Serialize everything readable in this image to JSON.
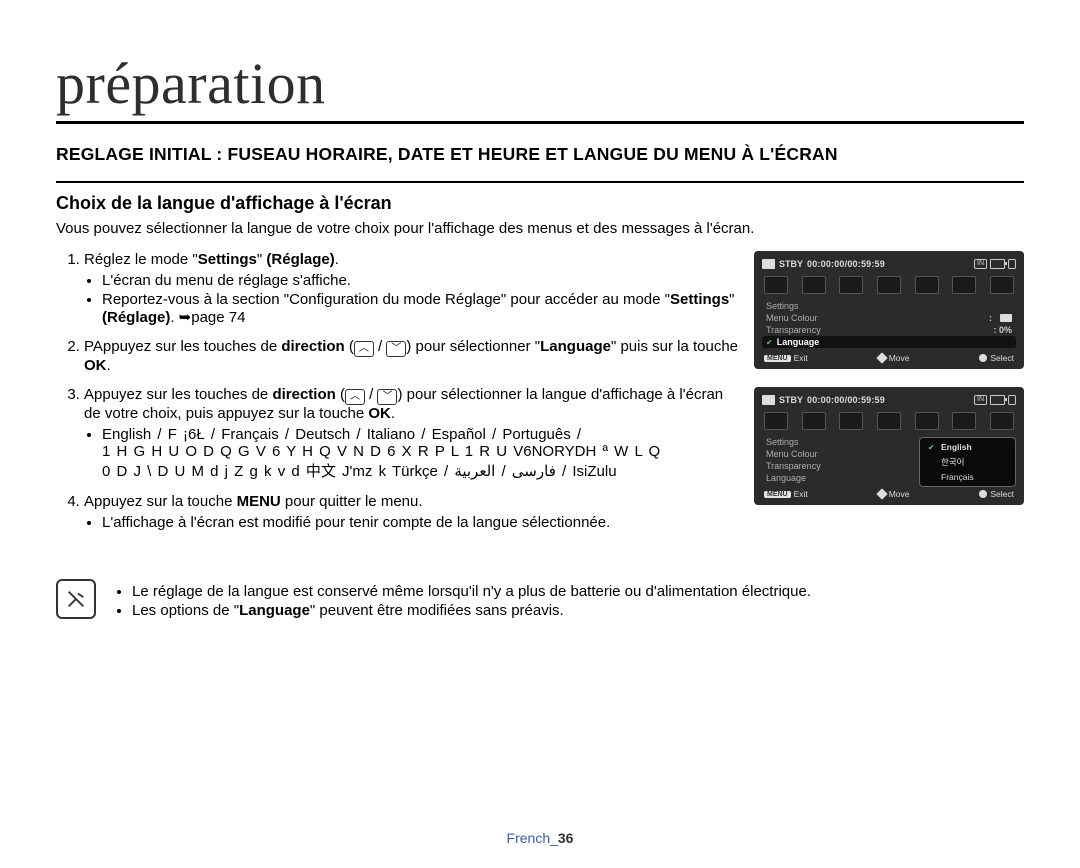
{
  "chapter": "préparation",
  "section_heading": "REGLAGE INITIAL : FUSEAU HORAIRE, DATE ET HEURE ET LANGUE DU MENU À L'ÉCRAN",
  "subheading": "Choix de la langue d'affichage à l'écran",
  "intro": "Vous pouvez sélectionner la langue de votre choix pour l'affichage des menus et des messages à  l'écran.",
  "steps": {
    "s1_a": "Réglez le mode \"",
    "s1_b_settings": "Settings",
    "s1_c_mid": "\" ",
    "s1_d_reg": "(Réglage)",
    "s1_e": ".",
    "s1_bullets": [
      "L'écran du menu de réglage s'affiche.",
      "Reportez-vous à la section \"Configuration du mode Réglage\" pour accéder au mode \""
    ],
    "s1_b2_settings": "Settings",
    "s1_b2_mid": "\" ",
    "s1_b2_reg": "(Réglage)",
    "s1_b2_end": ". ➥page 74",
    "s2_a": "PAppuyez sur les touches de ",
    "s2_dir": "direction",
    "s2_b": " (",
    "s2_c": " / ",
    "s2_d": ") pour sélectionner \"",
    "s2_lang": "Language",
    "s2_e": "\" puis sur la touche ",
    "s2_ok": "OK",
    "s2_f": ".",
    "s3_a": "Appuyez sur les touches de ",
    "s3_dir": "direction",
    "s3_b": " (",
    "s3_c": " / ",
    "s3_d": ") pour sélectionner la langue d'affichage à l'écran de votre choix, puis appuyez sur la touche ",
    "s3_ok": "OK",
    "s3_e": ".",
    "s3_langs_line1": "English /   F ¡6Ł  / Français / Deutsch / Italiano / Español / Português /",
    "s3_langs_line2": "1 H G H U O D Q G V       6 Y H Q V N D        6 X R P L        1 R U V6NORYDH                                     ª  W L Q",
    "s3_langs_line3": "0 D J \\ D U      M d j Z   g k v d 中文  J'mz k  Türkçe  / ﻓﺎرﺳﯽ / اﻟﻌﺮﺑﻴﺔ / IsiZulu",
    "s4_a": "Appuyez sur la touche ",
    "s4_menu": "MENU",
    "s4_b": " pour quitter le menu.",
    "s4_bullet": "L'affichage à l'écran est modifié pour tenir compte de la langue sélectionnée."
  },
  "notes": [
    "Le réglage de la langue est conservé même lorsqu'il n'y a plus de batterie ou d'alimentation électrique.",
    "Les options de \"Language\" peuvent être modifiées sans préavis."
  ],
  "notes_language_word": "Language",
  "footer_label": "French_",
  "footer_page": "36",
  "shots": {
    "stby": "STBY",
    "timecode": "00:00:00/00:59:59",
    "in_label": "IN",
    "menu": "MENU",
    "exit": "Exit",
    "move": "Move",
    "select": "Select",
    "rows": {
      "settings": "Settings",
      "menu_colour": "Menu Colour",
      "transparency": "Transparency",
      "transparency_val": "0%",
      "language": "Language"
    },
    "popup": {
      "english": "English",
      "korean": "한국어",
      "francais": "Français"
    }
  }
}
